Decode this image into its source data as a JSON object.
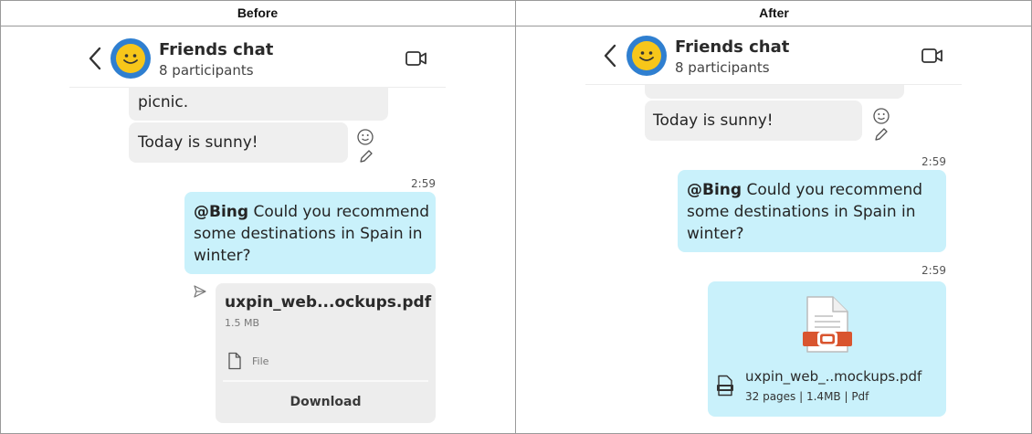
{
  "columns": {
    "before": "Before",
    "after": "After"
  },
  "chat": {
    "title": "Friends chat",
    "subtitle": "8 participants"
  },
  "icons": [
    "chevron-left-icon",
    "avatar-smiley-icon",
    "video-call-icon",
    "emoji-reaction-icon",
    "edit-pencil-icon",
    "send-arrow-icon",
    "file-icon",
    "pdf-document-icon",
    "pdf-badge-icon"
  ],
  "colors": {
    "outgoing_bubble": "#c9f1fb",
    "incoming_bubble": "#efefef",
    "avatar_ring": "#2f7fd0",
    "pdf_red": "#d9552f"
  },
  "before": {
    "incoming_partial": "picnic.",
    "incoming_message": "Today is sunny!",
    "timestamp": "2:59",
    "outgoing": {
      "mention": "@Bing",
      "text": " Could you recommend some destinations in Spain in winter?"
    },
    "file": {
      "name": "uxpin_web...ockups.pdf",
      "size": "1.5 MB",
      "type_label": "File",
      "download_label": "Download"
    }
  },
  "after": {
    "incoming_message": "Today is sunny!",
    "timestamp_message": "2:59",
    "outgoing": {
      "mention": "@Bing",
      "text": " Could you recommend some destinations in Spain in winter?"
    },
    "timestamp_file": "2:59",
    "file": {
      "name": "uxpin_web_..mockups.pdf",
      "meta": "32 pages | 1.4MB | Pdf"
    }
  }
}
